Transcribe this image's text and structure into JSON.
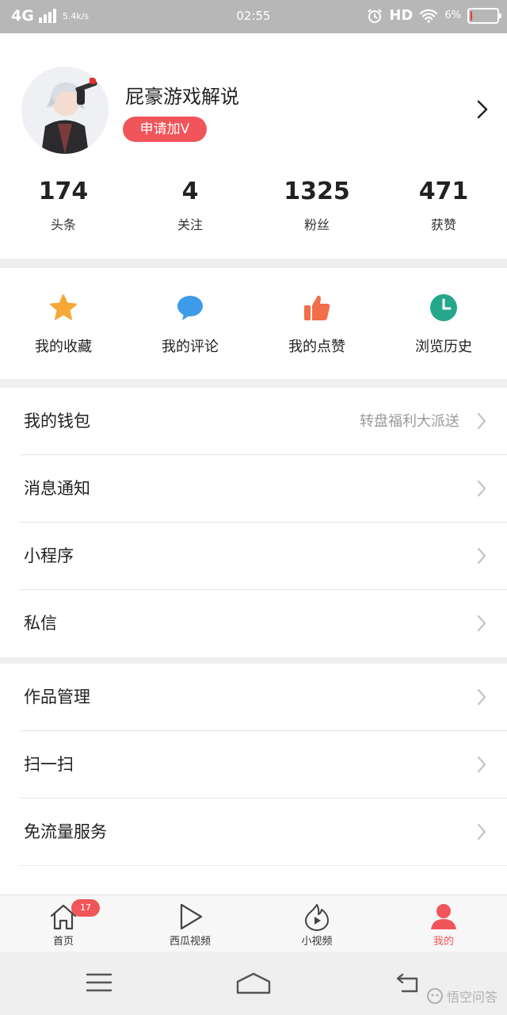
{
  "status_bar": {
    "network": "4G",
    "speed": "5.4k/s",
    "time": "02:55",
    "hd": "HD",
    "battery_pct": "6%",
    "battery_level": 0.06,
    "battery_color": "#e53935"
  },
  "profile": {
    "username": "屁豪游戏解说",
    "verify_label": "申请加V"
  },
  "stats": [
    {
      "value": "174",
      "label": "头条"
    },
    {
      "value": "4",
      "label": "关注"
    },
    {
      "value": "1325",
      "label": "粉丝"
    },
    {
      "value": "471",
      "label": "获赞"
    }
  ],
  "quick_actions": [
    {
      "label": "我的收藏",
      "icon": "star-icon",
      "color": "#f7a835"
    },
    {
      "label": "我的评论",
      "icon": "comment-icon",
      "color": "#3d9be9"
    },
    {
      "label": "我的点赞",
      "icon": "thumbs-up-icon",
      "color": "#f26e4a"
    },
    {
      "label": "浏览历史",
      "icon": "clock-icon",
      "color": "#24a78a"
    }
  ],
  "menu_groups": [
    [
      {
        "label": "我的钱包",
        "hint": "转盘福利大派送"
      },
      {
        "label": "消息通知",
        "hint": ""
      },
      {
        "label": "小程序",
        "hint": ""
      },
      {
        "label": "私信",
        "hint": ""
      }
    ],
    [
      {
        "label": "作品管理",
        "hint": ""
      },
      {
        "label": "扫一扫",
        "hint": ""
      },
      {
        "label": "免流量服务",
        "hint": ""
      }
    ]
  ],
  "tabbar": {
    "tabs": [
      {
        "label": "首页",
        "icon": "home-icon",
        "badge": "17"
      },
      {
        "label": "西瓜视频",
        "icon": "play-icon"
      },
      {
        "label": "小视频",
        "icon": "flame-play-icon"
      },
      {
        "label": "我的",
        "icon": "person-icon",
        "active": true
      }
    ]
  },
  "colors": {
    "accent": "#f0555a"
  },
  "watermark": {
    "text": "悟空问答"
  }
}
